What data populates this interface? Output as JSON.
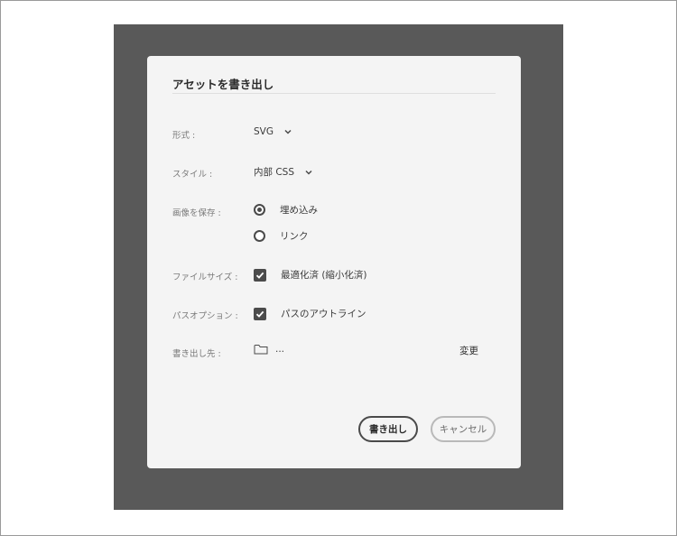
{
  "dialog": {
    "title": "アセットを書き出し",
    "format": {
      "label": "形式 :",
      "value": "SVG"
    },
    "style": {
      "label": "スタイル :",
      "value": "内部 CSS"
    },
    "save_images": {
      "label": "画像を保存 :",
      "options": [
        {
          "label": "埋め込み",
          "selected": true
        },
        {
          "label": "リンク",
          "selected": false
        }
      ]
    },
    "file_size": {
      "label": "ファイルサイズ :",
      "checkbox_label": "最適化済 (縮小化済)",
      "checked": true
    },
    "path_options": {
      "label": "パスオプション :",
      "checkbox_label": "パスのアウトライン",
      "checked": true
    },
    "destination": {
      "label": "書き出し先 :",
      "value": "...",
      "change_label": "変更"
    },
    "buttons": {
      "export": "書き出し",
      "cancel": "キャンセル"
    }
  },
  "colors": {
    "backdrop": "#595959",
    "dialog_bg": "#f4f4f4",
    "control": "#4a4a4a"
  }
}
